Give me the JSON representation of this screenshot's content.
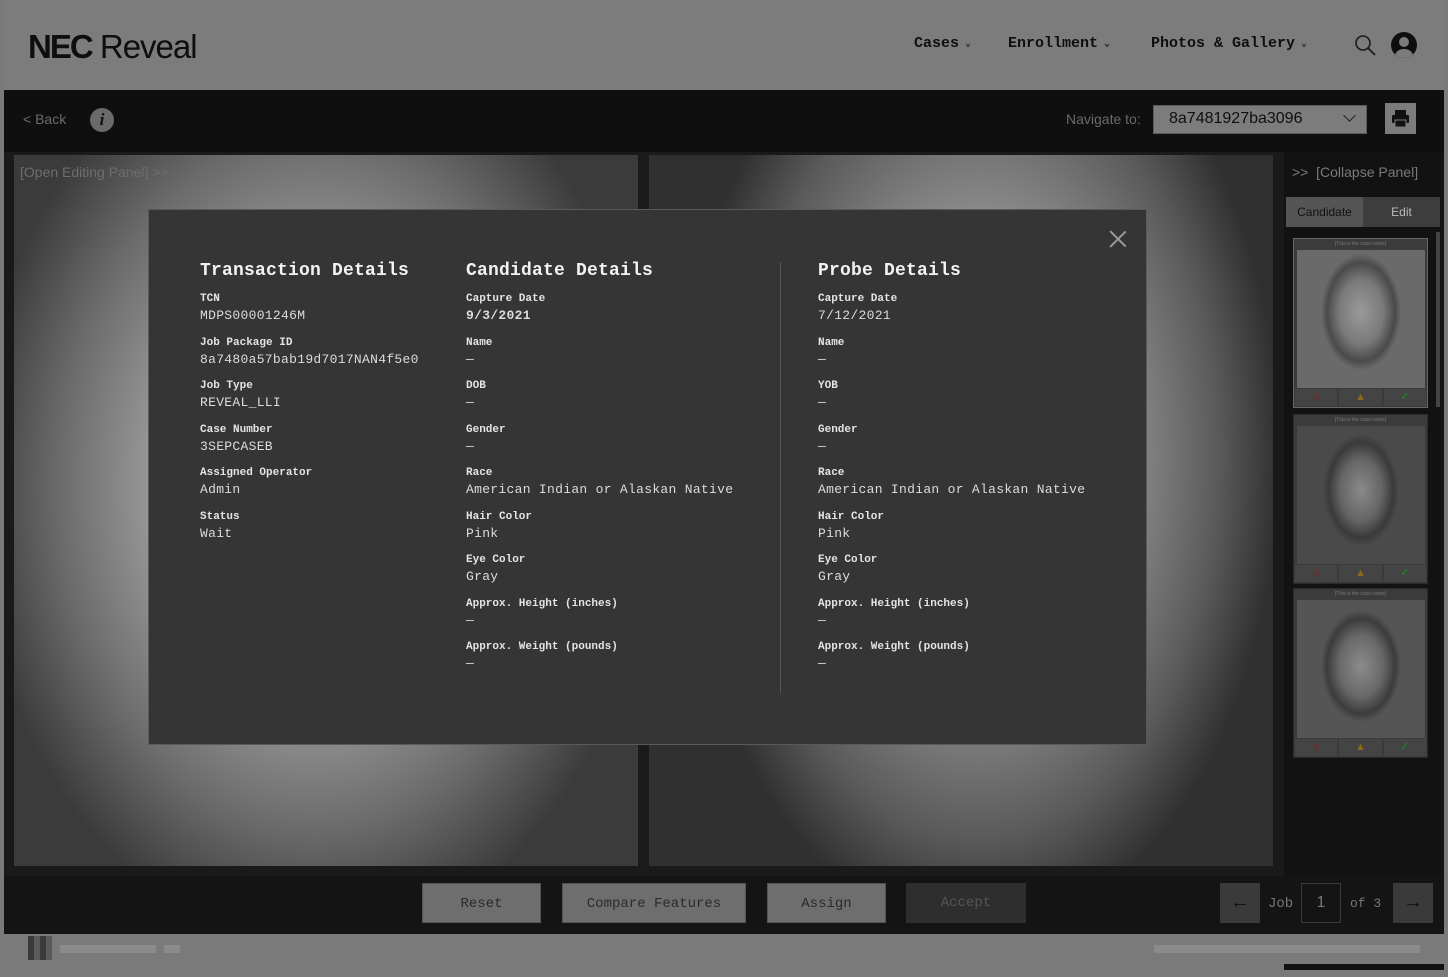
{
  "header": {
    "brand_bold": "NEC",
    "brand_light": "Reveal",
    "nav": [
      "Cases",
      "Enrollment",
      "Photos & Gallery"
    ],
    "icons": [
      "search-icon",
      "user-icon",
      "chevron-down-icon"
    ]
  },
  "toolbar": {
    "back_label": "< Back",
    "info_glyph": "i",
    "navigate_label": "Navigate to:",
    "navigate_value": "8a7481927ba3096"
  },
  "workspace": {
    "open_editing_label": "[Open Editing Panel]",
    "open_editing_glyph": ">>"
  },
  "right_panel": {
    "collapse_glyph": ">>",
    "collapse_label": "[Collapse Panel]",
    "tabs": [
      "Candidate",
      "Edit"
    ],
    "active_tab": "Candidate",
    "candidates": [
      {
        "title": "[This is the case name]"
      },
      {
        "title": "[This is the case name]"
      },
      {
        "title": "[This is the case name]"
      }
    ]
  },
  "modal": {
    "transaction": {
      "title": "Transaction Details",
      "fields": [
        {
          "label": "TCN",
          "value": "MDPS00001246M"
        },
        {
          "label": "Job Package ID",
          "value": "8a7480a57bab19d7017NAN4f5e0"
        },
        {
          "label": "Job Type",
          "value": "REVEAL_LLI"
        },
        {
          "label": "Case Number",
          "value": "3SEPCASEB"
        },
        {
          "label": "Assigned Operator",
          "value": "Admin"
        },
        {
          "label": "Status",
          "value": "Wait"
        }
      ]
    },
    "candidate": {
      "title": "Candidate Details",
      "fields": [
        {
          "label": "Capture Date",
          "value": "9/3/2021"
        },
        {
          "label": "Name",
          "value": "—"
        },
        {
          "label": "DOB",
          "value": "—"
        },
        {
          "label": "Gender",
          "value": "—"
        },
        {
          "label": "Race",
          "value": "American Indian or Alaskan Native"
        },
        {
          "label": "Hair Color",
          "value": "Pink"
        },
        {
          "label": "Eye Color",
          "value": "Gray"
        },
        {
          "label": "Approx. Height (inches)",
          "value": "—"
        },
        {
          "label": "Approx. Weight (pounds)",
          "value": "—"
        }
      ]
    },
    "probe": {
      "title": "Probe Details",
      "fields": [
        {
          "label": "Capture Date",
          "value": "7/12/2021"
        },
        {
          "label": "Name",
          "value": "—"
        },
        {
          "label": "YOB",
          "value": "—"
        },
        {
          "label": "Gender",
          "value": "—"
        },
        {
          "label": "Race",
          "value": "American Indian or Alaskan Native"
        },
        {
          "label": "Hair Color",
          "value": "Pink"
        },
        {
          "label": "Eye Color",
          "value": "Gray"
        },
        {
          "label": "Approx. Height (inches)",
          "value": "—"
        },
        {
          "label": "Approx. Weight (pounds)",
          "value": "—"
        }
      ]
    }
  },
  "actions": {
    "reset": "Reset",
    "compare": "Compare Features",
    "assign": "Assign",
    "accept": "Accept"
  },
  "pager": {
    "prev": "←",
    "job_label": "Job",
    "current": "1",
    "of_label": "of 3",
    "next": "→"
  }
}
